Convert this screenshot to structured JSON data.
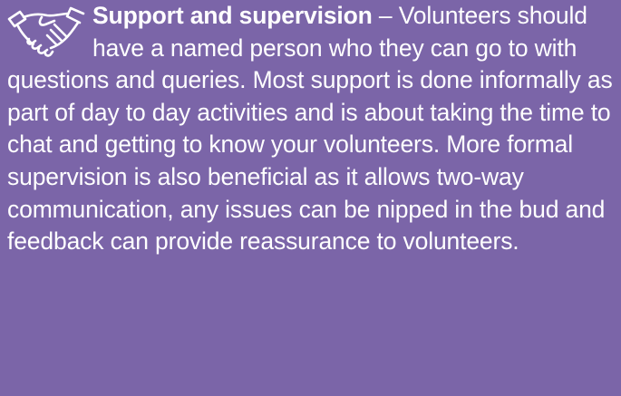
{
  "section": {
    "icon": "handshake-icon",
    "title": "Support and supervision",
    "separator": " – ",
    "body": "Volunteers should have a named person who they can go to with questions and queries. Most support is done informally as part of day to day activities and is about taking the time to chat and getting to know your volunteers. More formal supervision is also beneficial as it allows two-way communication, any issues can be nipped in the bud and feedback can provide reassurance to volunteers."
  },
  "colors": {
    "background": "#7b65a8",
    "text": "#ffffff"
  }
}
